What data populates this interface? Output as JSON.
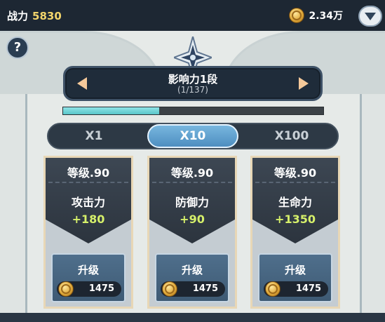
{
  "header": {
    "power_label": "战力",
    "power_value": "5830",
    "coin_amount": "2.34万"
  },
  "help": {
    "label": "?"
  },
  "stage": {
    "title": "影响力1段",
    "subtitle": "(1/137)",
    "progress": 0.37
  },
  "multipliers": [
    {
      "label": "X1",
      "active": false
    },
    {
      "label": "X10",
      "active": true
    },
    {
      "label": "X100",
      "active": false
    }
  ],
  "cards": [
    {
      "level": "等级.90",
      "stat": "攻击力",
      "bonus": "+180",
      "button": "升级",
      "cost": "1475"
    },
    {
      "level": "等级.90",
      "stat": "防御力",
      "bonus": "+90",
      "button": "升级",
      "cost": "1475"
    },
    {
      "level": "等级.90",
      "stat": "生命力",
      "bonus": "+1350",
      "button": "升级",
      "cost": "1475"
    }
  ],
  "colors": {
    "accent_gold": "#f2d46b",
    "bonus_green": "#d6f06a",
    "progress_cyan": "#59c5c9"
  },
  "icons": {
    "coin": "gold-coin-icon",
    "dropdown": "chevron-down-icon",
    "help": "question-icon"
  }
}
